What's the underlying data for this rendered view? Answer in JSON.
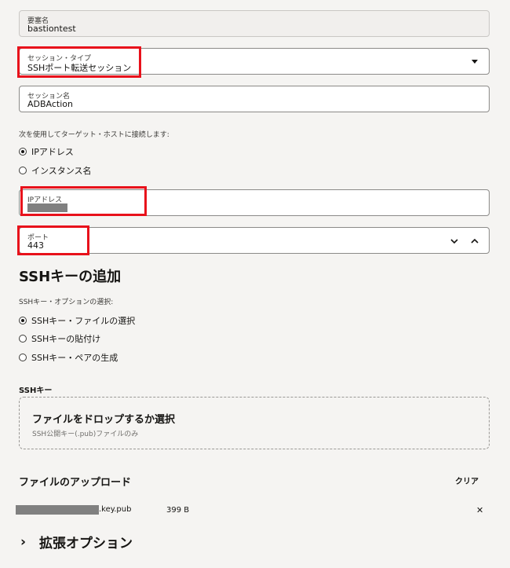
{
  "form": {
    "element_name": {
      "label": "要塞名",
      "value": "bastiontest"
    },
    "session_type": {
      "label": "セッション・タイプ",
      "value": "SSHポート転送セッション"
    },
    "session_name": {
      "label": "セッション名",
      "value": "ADBAction"
    },
    "connect_prompt": "次を使用してターゲット・ホストに接続します:",
    "connect_options": [
      {
        "label": "IPアドレス",
        "selected": true
      },
      {
        "label": "インスタンス名",
        "selected": false
      }
    ],
    "ip_address": {
      "label": "IPアドレス",
      "value": ""
    },
    "port": {
      "label": "ポート",
      "value": "443"
    }
  },
  "ssh": {
    "heading": "SSHキーの追加",
    "option_prompt": "SSHキー・オプションの選択:",
    "options": [
      {
        "label": "SSHキー・ファイルの選択",
        "selected": true
      },
      {
        "label": "SSHキーの貼付け",
        "selected": false
      },
      {
        "label": "SSHキー・ペアの生成",
        "selected": false
      }
    ],
    "key_label": "SSHキー",
    "dropzone": {
      "title": "ファイルをドロップするか選択",
      "subtitle": "SSH公開キー(.pub)ファイルのみ"
    }
  },
  "upload": {
    "heading": "ファイルのアップロード",
    "clear_label": "クリア",
    "file": {
      "name_suffix": ".key.pub",
      "size": "399 B"
    },
    "remove_glyph": "✕"
  },
  "advanced": {
    "label": "拡張オプション",
    "chevron_glyph": "›"
  },
  "colors": {
    "highlight": "#e8111b",
    "redaction": "#808080"
  }
}
